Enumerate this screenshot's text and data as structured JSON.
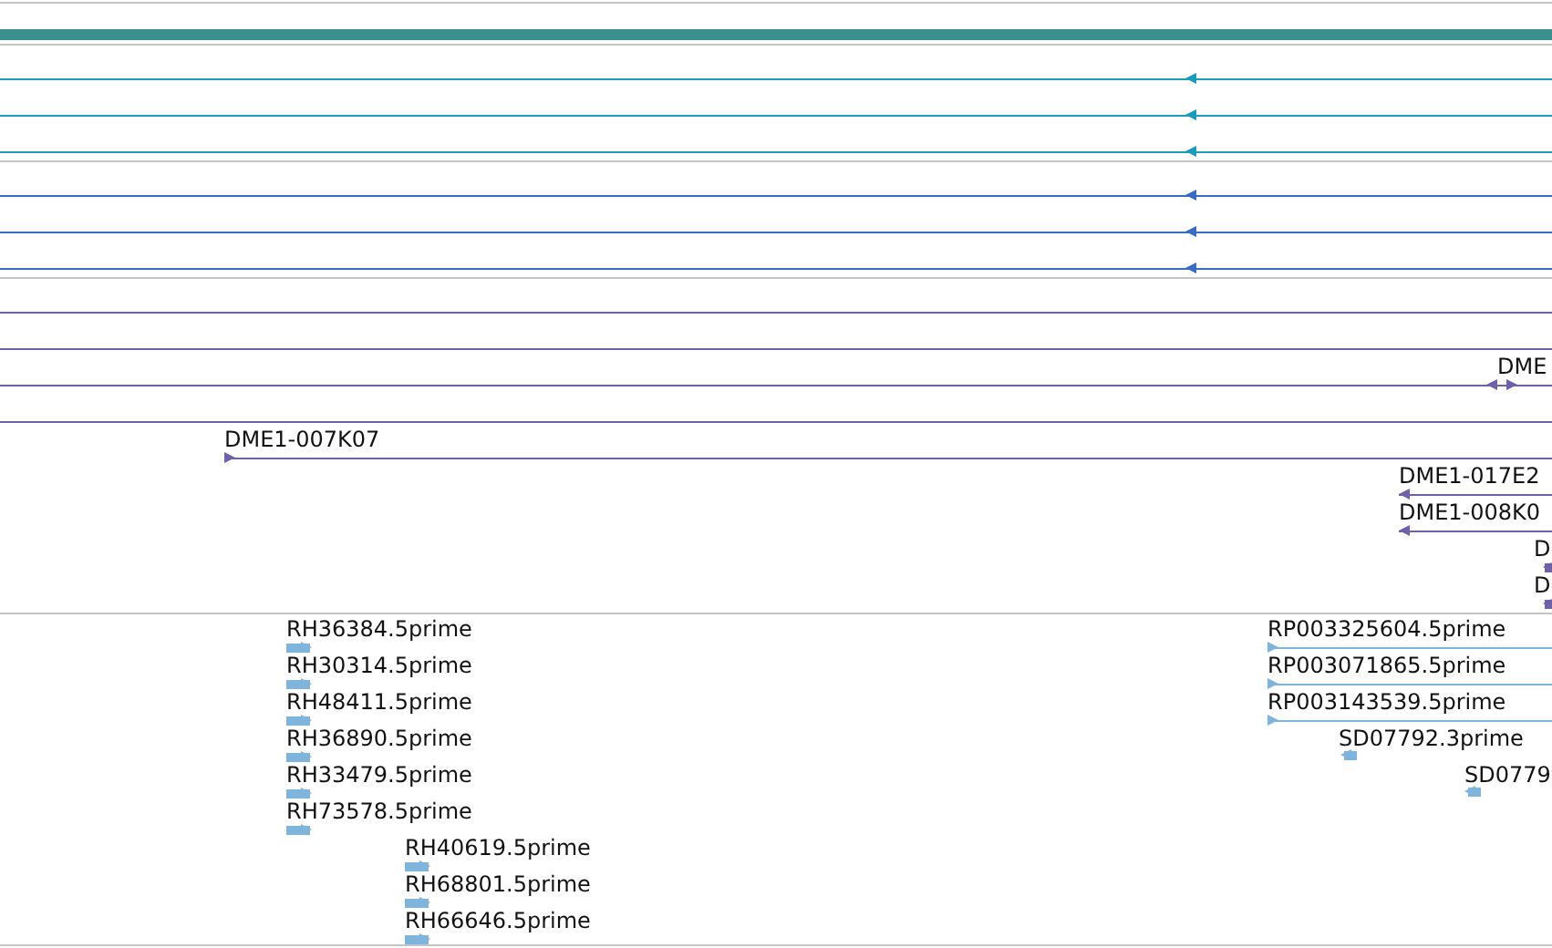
{
  "tracks": [
    {
      "kind": "bar",
      "color": "#3d8f8f"
    },
    {
      "kind": "features",
      "color": "#1a9cbc",
      "features": [
        {
          "kind": "leftward"
        },
        {
          "kind": "leftward"
        },
        {
          "kind": "leftward"
        }
      ]
    },
    {
      "kind": "features",
      "color": "#3a6bc4",
      "features": [
        {
          "kind": "leftward"
        },
        {
          "kind": "leftward"
        },
        {
          "kind": "leftward"
        }
      ]
    },
    {
      "kind": "features",
      "color": "#7060a8",
      "features": [
        {
          "kind": "plain"
        },
        {
          "kind": "plain"
        },
        {
          "label": "DME",
          "kind": "bidirectional"
        },
        {
          "kind": "plain"
        },
        {
          "label": "DME1-007K07",
          "kind": "rightward"
        },
        {
          "label": "DME1-017E2",
          "kind": "leftward"
        },
        {
          "label": "DME1-008K0",
          "kind": "leftward"
        },
        {
          "label": "D",
          "kind": "leftward"
        },
        {
          "label": "D",
          "kind": "leftward"
        }
      ]
    },
    {
      "kind": "features",
      "color": "#7fb4dc",
      "features": [
        {
          "label": "RH36384.5prime",
          "kind": "rightward"
        },
        {
          "label": "RH30314.5prime",
          "kind": "rightward"
        },
        {
          "label": "RH48411.5prime",
          "kind": "rightward"
        },
        {
          "label": "RH36890.5prime",
          "kind": "rightward"
        },
        {
          "label": "RH33479.5prime",
          "kind": "rightward"
        },
        {
          "label": "RH73578.5prime",
          "kind": "rightward"
        },
        {
          "label": "RH40619.5prime",
          "kind": "rightward"
        },
        {
          "label": "RH68801.5prime",
          "kind": "rightward"
        },
        {
          "label": "RH66646.5prime",
          "kind": "rightward"
        },
        {
          "label": "RP003325604.5prime",
          "kind": "rightward"
        },
        {
          "label": "RP003071865.5prime",
          "kind": "rightward"
        },
        {
          "label": "RP003143539.5prime",
          "kind": "rightward"
        },
        {
          "label": "SD07792.3prime",
          "kind": "leftward"
        },
        {
          "label": "SD0779",
          "kind": "leftward"
        }
      ]
    }
  ]
}
